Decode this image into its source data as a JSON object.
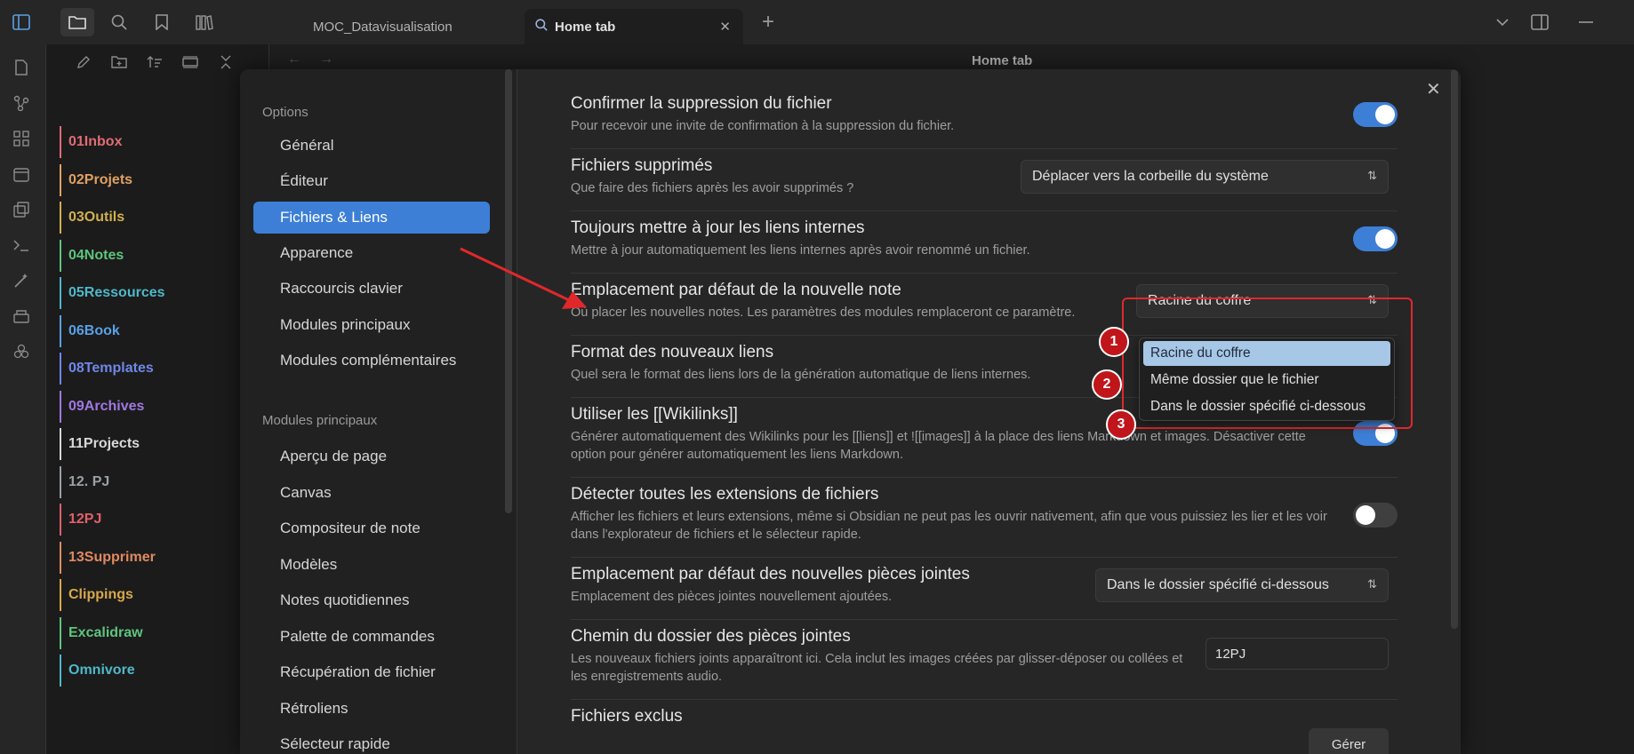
{
  "topbar": {
    "tabs": [
      {
        "label": "MOC_Datavisualisation"
      },
      {
        "label": "Home tab"
      }
    ],
    "new_tab_label": "+",
    "close_label": "✕"
  },
  "file_explorer": {
    "folders": [
      {
        "label": "01Inbox",
        "color": "#e06c75"
      },
      {
        "label": "02Projets",
        "color": "#e0a064"
      },
      {
        "label": "03Outils",
        "color": "#d0b050"
      },
      {
        "label": "04Notes",
        "color": "#5ec47e"
      },
      {
        "label": "05Ressources",
        "color": "#4fb8c9"
      },
      {
        "label": "06Book",
        "color": "#5aa0e6"
      },
      {
        "label": "08Templates",
        "color": "#6f87e8"
      },
      {
        "label": "09Archives",
        "color": "#a078e0"
      },
      {
        "label": "11Projects",
        "color": "#d8d8d8"
      },
      {
        "label": "12. PJ",
        "color": "#9aa0a6"
      },
      {
        "label": "12PJ",
        "color": "#e0606a"
      },
      {
        "label": "13Supprimer",
        "color": "#e08a60"
      },
      {
        "label": "Clippings",
        "color": "#d8a84a"
      },
      {
        "label": "Excalidraw",
        "color": "#5ec47e"
      },
      {
        "label": "Omnivore",
        "color": "#4fb8c9"
      }
    ]
  },
  "main": {
    "header_title": "Home tab",
    "back_label": "←",
    "forward_label": "→"
  },
  "settings_nav": {
    "options_heading": "Options",
    "options_items": [
      "Général",
      "Éditeur",
      "Fichiers & Liens",
      "Apparence",
      "Raccourcis clavier",
      "Modules principaux",
      "Modules complémentaires"
    ],
    "selected": "Fichiers & Liens",
    "core_heading": "Modules principaux",
    "core_items": [
      "Aperçu de page",
      "Canvas",
      "Compositeur de note",
      "Modèles",
      "Notes quotidiennes",
      "Palette de commandes",
      "Récupération de fichier",
      "Rétroliens",
      "Sélecteur rapide"
    ]
  },
  "settings": {
    "close_label": "✕",
    "confirm_delete": {
      "name": "Confirmer la suppression du fichier",
      "desc": "Pour recevoir une invite de confirmation à la suppression du fichier.",
      "enabled": true
    },
    "deleted_files": {
      "name": "Fichiers supprimés",
      "desc": "Que faire des fichiers après les avoir supprimés ?",
      "value": "Déplacer vers la corbeille du système"
    },
    "update_links": {
      "name": "Toujours mettre à jour les liens internes",
      "desc": "Mettre à jour automatiquement les liens internes après avoir renommé un fichier.",
      "enabled": true
    },
    "new_note_location": {
      "name": "Emplacement par défaut de la nouvelle note",
      "desc": "Où placer les nouvelles notes. Les paramètres des modules remplaceront ce paramètre.",
      "value": "Racine du coffre",
      "options": [
        "Racine du coffre",
        "Même dossier que le fichier",
        "Dans le dossier spécifié ci-dessous"
      ],
      "markers": [
        "1",
        "2",
        "3"
      ]
    },
    "link_format": {
      "name": "Format des nouveaux liens",
      "desc": "Quel sera le format des liens lors de la génération automatique de liens internes."
    },
    "wikilinks": {
      "name": "Utiliser les [[Wikilinks]]",
      "desc": "Générer automatiquement des Wikilinks pour les [[liens]] et ![[images]] à la place des liens Markdown et images. Désactiver cette option pour générer automatiquement les liens Markdown.",
      "enabled": true
    },
    "detect_extensions": {
      "name": "Détecter toutes les extensions de fichiers",
      "desc": "Afficher les fichiers et leurs extensions, même si Obsidian ne peut pas les ouvrir nativement, afin que vous puissiez les lier et les voir dans l'explorateur de fichiers et le sélecteur rapide.",
      "enabled": false
    },
    "attachment_location": {
      "name": "Emplacement par défaut des nouvelles pièces jointes",
      "desc": "Emplacement des pièces jointes nouvellement ajoutées.",
      "value": "Dans le dossier spécifié ci-dessous"
    },
    "attachment_folder": {
      "name": "Chemin du dossier des pièces jointes",
      "desc": "Les nouveaux fichiers joints apparaîtront ici. Cela inclut les images créées par glisser-déposer ou collées et les enregistrements audio.",
      "value": "12PJ"
    },
    "excluded_files": {
      "name": "Fichiers exclus",
      "button": "Gérer"
    }
  }
}
